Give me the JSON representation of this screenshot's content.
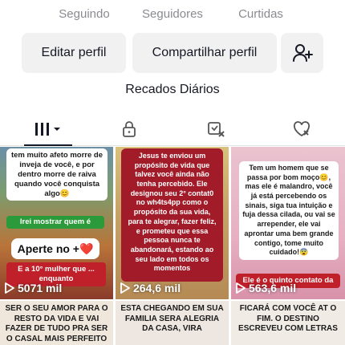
{
  "stats": {
    "following_label": "Seguindo",
    "followers_label": "Seguidores",
    "likes_label": "Curtidas"
  },
  "actions": {
    "edit_label": "Editar perfil",
    "share_label": "Compartilhar perfil",
    "add_friend_icon": "person-plus-icon"
  },
  "playlist": {
    "title": "Recados Diários"
  },
  "tabs": [
    {
      "icon": "grid-icon",
      "active": true
    },
    {
      "icon": "lock-icon",
      "active": false
    },
    {
      "icon": "repost-icon",
      "active": false
    },
    {
      "icon": "heart-icon",
      "active": false
    }
  ],
  "videos": [
    {
      "caption_top": "tem muito afeto morre de inveja de você, e por dentro morre de raiva quando você conquista algo😊",
      "caption_green": "Irei mostrar quem é",
      "button_text": "Aperte no +❤️",
      "caption_bottom": "E a 10° mulher que ... enquanto",
      "views": "5071 mil"
    },
    {
      "caption": "Jesus te enviou um propósito de vida que talvez você ainda não tenha percebido. Ele designou seu 2° contat0 no wh4ts4pp como o propósito da sua vida, para te alegrar, fazer feliz, e prometeu que essa pessoa nunca te abandonará, estando ao seu lado em todos os momentos",
      "views": "264,6 mil"
    },
    {
      "caption_top": "Tem um homem que se passa por bom moço😊, mas ele é malandro, você já está percebendo os sinais, siga tua intuição e fuja dessa cilada, ou vai se arrepender, ele vai aprontar uma bem grande contigo, tome muito cuidado!😨",
      "caption_bottom": "Ele é o quinto contato da",
      "views": "563,6 mil"
    },
    {
      "caption": "SER O SEU AMOR PARA O RESTO DA VIDA E VAI FAZER DE TUDO PRA SER O CASAL MAIS PERFEITO DE"
    },
    {
      "caption": "ESTA CHEGANDO EM SUA FAMILIA SERA ALEGRIA DA CASA, VIRA"
    },
    {
      "caption": "FICARÁ COM VOCÊ AT O FIM. O DESTINO ESCREVEU COM LETRAS"
    }
  ]
}
